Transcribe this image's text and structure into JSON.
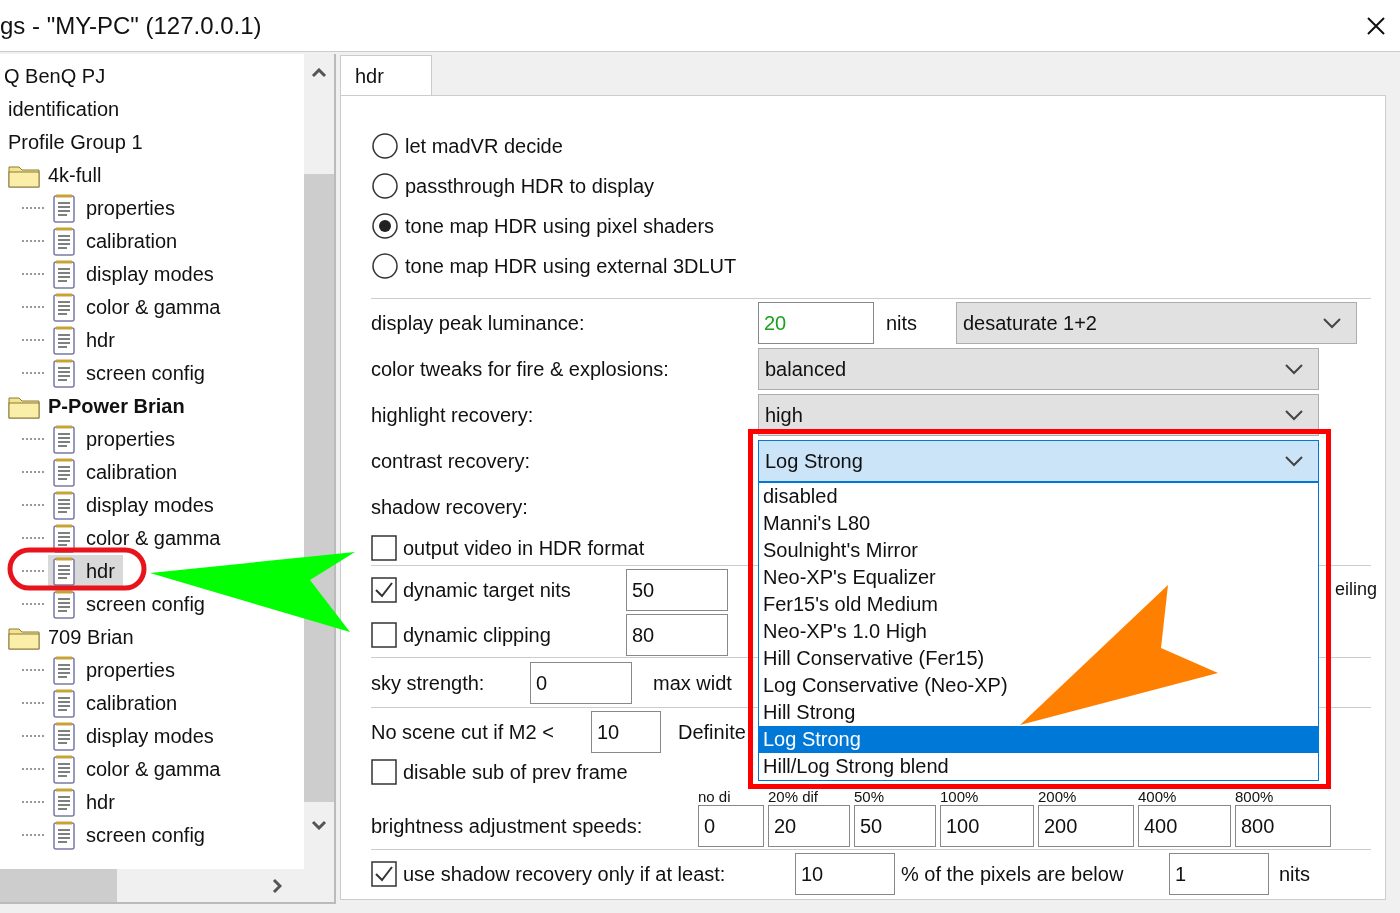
{
  "window": {
    "title": "gs - \"MY-PC\" (127.0.0.1)"
  },
  "tree": {
    "items": [
      {
        "label": "Q BenQ PJ",
        "kind": "root",
        "children": [
          {
            "label": "identification",
            "kind": "text"
          },
          {
            "label": "Profile Group 1",
            "kind": "text"
          },
          {
            "label": "4k-full",
            "kind": "folder",
            "active": false,
            "children": [
              {
                "label": "properties",
                "kind": "page",
                "selected": false
              },
              {
                "label": "calibration",
                "kind": "page",
                "selected": false
              },
              {
                "label": "display modes",
                "kind": "page",
                "selected": false
              },
              {
                "label": "color & gamma",
                "kind": "page",
                "selected": false
              },
              {
                "label": "hdr",
                "kind": "page",
                "selected": false
              },
              {
                "label": "screen config",
                "kind": "page",
                "selected": false
              }
            ]
          },
          {
            "label": "P-Power Brian",
            "kind": "folder",
            "active": true,
            "children": [
              {
                "label": "properties",
                "kind": "page",
                "selected": false
              },
              {
                "label": "calibration",
                "kind": "page",
                "selected": false
              },
              {
                "label": "display modes",
                "kind": "page",
                "selected": false
              },
              {
                "label": "color & gamma",
                "kind": "page",
                "selected": false
              },
              {
                "label": "hdr",
                "kind": "page",
                "selected": true
              },
              {
                "label": "screen config",
                "kind": "page",
                "selected": false
              }
            ]
          },
          {
            "label": "709 Brian",
            "kind": "folder",
            "active": false,
            "children": [
              {
                "label": "properties",
                "kind": "page",
                "selected": false
              },
              {
                "label": "calibration",
                "kind": "page",
                "selected": false
              },
              {
                "label": "display modes",
                "kind": "page",
                "selected": false
              },
              {
                "label": "color & gamma",
                "kind": "page",
                "selected": false
              },
              {
                "label": "hdr",
                "kind": "page",
                "selected": false
              },
              {
                "label": "screen config",
                "kind": "page",
                "selected": false
              }
            ]
          }
        ]
      }
    ]
  },
  "tabs": [
    {
      "label": "hdr",
      "selected": true
    }
  ],
  "radios": [
    {
      "label": "let madVR decide",
      "selected": false
    },
    {
      "label": "passthrough HDR to display",
      "selected": false
    },
    {
      "label": "tone map HDR using pixel shaders",
      "selected": true
    },
    {
      "label": "tone map HDR using external 3DLUT",
      "selected": false
    }
  ],
  "luminance": {
    "label": "display peak luminance:",
    "value": "20",
    "unit": "nits",
    "mode": "desaturate 1+2"
  },
  "selects": [
    {
      "label": "color tweaks for fire & explosions:",
      "value": "balanced",
      "open": false
    },
    {
      "label": "highlight recovery:",
      "value": "high",
      "open": false
    },
    {
      "label": "contrast recovery:",
      "value": "Log Strong",
      "open": true,
      "options": [
        {
          "label": "disabled",
          "selected": false
        },
        {
          "label": "Manni's L80",
          "selected": false
        },
        {
          "label": "Soulnight's Mirror",
          "selected": false
        },
        {
          "label": "Neo-XP's Equalizer",
          "selected": false
        },
        {
          "label": "Fer15's old Medium",
          "selected": false
        },
        {
          "label": "Neo-XP's 1.0 High",
          "selected": false
        },
        {
          "label": "Hill Conservative (Fer15)",
          "selected": false
        },
        {
          "label": "Log Conservative (Neo-XP)",
          "selected": false
        },
        {
          "label": "Hill Strong",
          "selected": false
        },
        {
          "label": "Log Strong",
          "selected": true
        },
        {
          "label": "Hill/Log Strong blend",
          "selected": false
        }
      ]
    },
    {
      "label": "shadow recovery:"
    }
  ],
  "output_hdr": {
    "label": "output video in HDR format",
    "checked": false
  },
  "dynamic": [
    {
      "label": "dynamic target nits",
      "checked": true,
      "value": "50"
    },
    {
      "label": "dynamic clipping",
      "checked": false,
      "value": "80"
    }
  ],
  "ceiling_fragment": "eiling",
  "sky": {
    "label": "sky strength:",
    "value": "0",
    "next_label": "max widt"
  },
  "scene_cut": {
    "label": "No scene cut if M2 <",
    "value": "10",
    "next_label": "Definite"
  },
  "disable_sub": {
    "label": "disable sub of prev frame",
    "checked": false
  },
  "speeds": {
    "label": "brightness adjustment speeds:",
    "columns": [
      {
        "header": "no di",
        "value": "0"
      },
      {
        "header": "20% dif",
        "value": "20"
      },
      {
        "header": "50%",
        "value": "50"
      },
      {
        "header": "100%",
        "value": "100"
      },
      {
        "header": "200%",
        "value": "200"
      },
      {
        "header": "400%",
        "value": "400"
      },
      {
        "header": "800%",
        "value": "800"
      }
    ]
  },
  "shadow_only": {
    "label": "use shadow recovery only if at least:",
    "checked": true,
    "value": "10",
    "middle": "% of the pixels are below",
    "value_2": "1",
    "unit": "nits"
  }
}
